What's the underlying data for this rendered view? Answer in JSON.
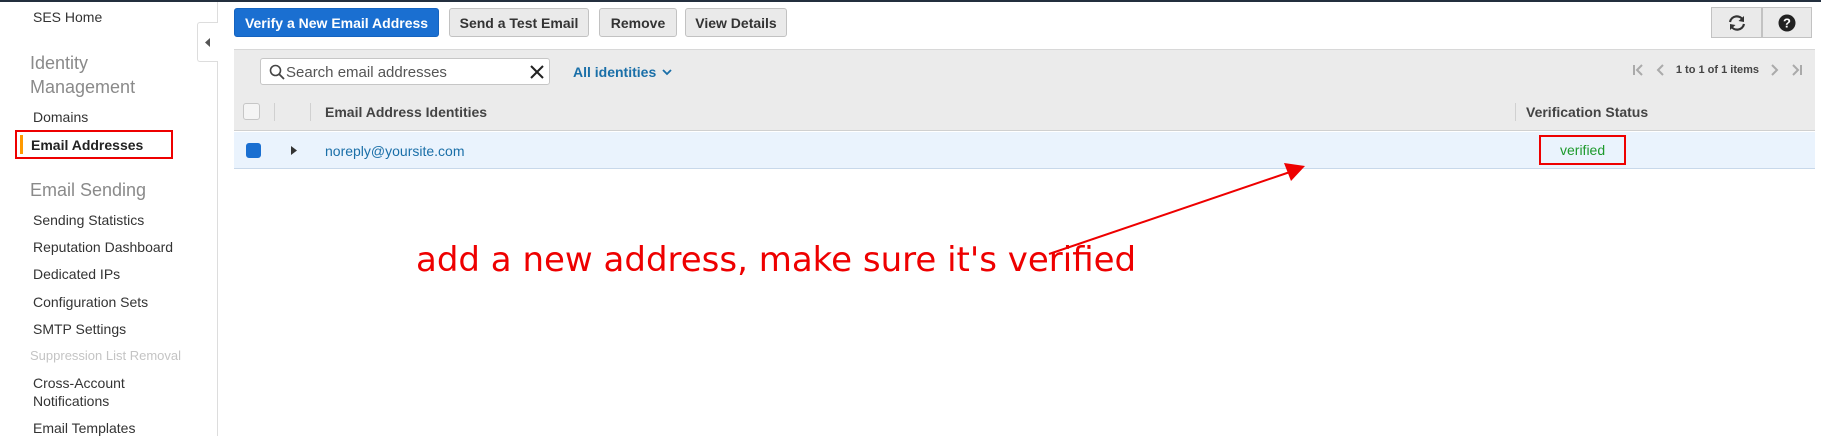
{
  "sidebar": {
    "home": "SES Home",
    "identity_section": "Identity Management",
    "identity_items": [
      "Domains",
      "Email Addresses"
    ],
    "sending_section": "Email Sending",
    "sending_items": [
      "Sending Statistics",
      "Reputation Dashboard",
      "Dedicated IPs",
      "Configuration Sets",
      "SMTP Settings"
    ],
    "disabled_item": "Suppression List Removal",
    "cross_account": "Cross-Account Notifications",
    "templates": "Email Templates"
  },
  "toolbar": {
    "verify_label": "Verify a New Email Address",
    "test_label": "Send a Test Email",
    "remove_label": "Remove",
    "details_label": "View Details",
    "refresh_icon": "refresh-icon",
    "help_icon": "help-icon"
  },
  "filter": {
    "search_placeholder": "Search email addresses",
    "identities_filter": "All identities",
    "pager_text": "1 to 1 of 1 items"
  },
  "table": {
    "headers": [
      "Email Address Identities",
      "Verification Status"
    ],
    "rows": [
      {
        "email": "noreply@yoursite.com",
        "status": "verified",
        "selected": true
      }
    ]
  },
  "annotation": {
    "text": "add a new address, make sure it's verified"
  },
  "colors": {
    "primary": "#1a6fd1",
    "link": "#1a6fa8",
    "verified": "#1d9a2c",
    "annotation": "#ee0000",
    "active_marker": "#ff9900"
  }
}
